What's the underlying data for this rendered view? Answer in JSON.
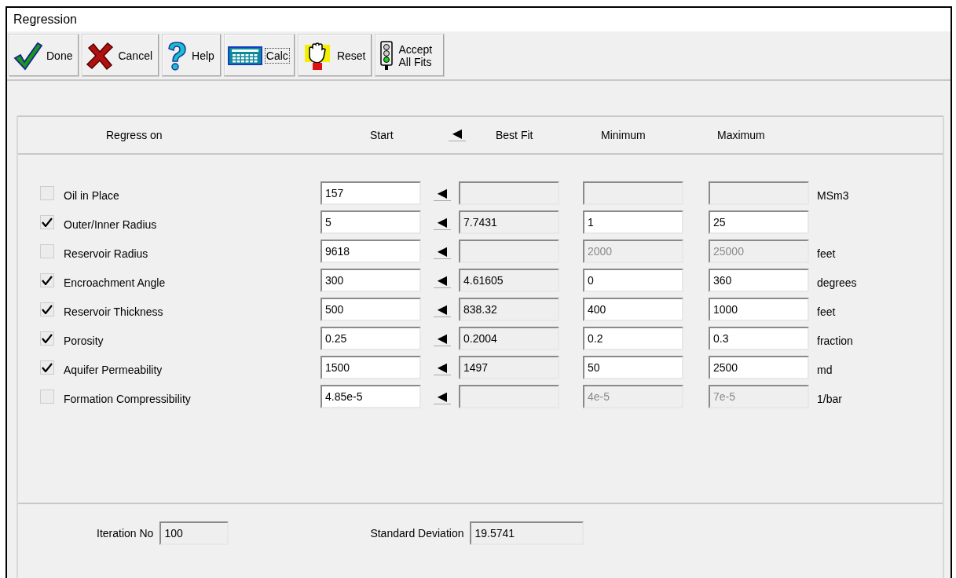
{
  "window": {
    "title": "Regression"
  },
  "toolbar": [
    {
      "kind": "done",
      "label": "Done",
      "focused": false
    },
    {
      "kind": "cancel",
      "label": "Cancel",
      "focused": false
    },
    {
      "kind": "help",
      "label": "Help",
      "focused": false
    },
    {
      "kind": "calc",
      "label": "Calc",
      "focused": true
    },
    {
      "kind": "reset",
      "label": "Reset",
      "focused": false
    },
    {
      "kind": "accept",
      "label": "Accept All Fits",
      "focused": false
    }
  ],
  "table": {
    "columns": [
      "Regress on",
      "Start",
      "◀",
      "Best Fit",
      "Minimum",
      "Maximum"
    ],
    "rows": [
      {
        "checked": false,
        "label": "Oil in Place",
        "start": "157",
        "arrow": "◀",
        "best_fit": "",
        "minimum": "",
        "maximum": "",
        "limits_enabled": false,
        "unit": "MSm3"
      },
      {
        "checked": true,
        "label": "Outer/Inner Radius",
        "start": "5",
        "arrow": "◀",
        "best_fit": "7.7431",
        "minimum": "1",
        "maximum": "25",
        "limits_enabled": true
      },
      {
        "checked": false,
        "label": "Reservoir Radius",
        "start": "9618",
        "arrow": "◀",
        "best_fit": "",
        "minimum": "2000",
        "maximum": "25000",
        "limits_enabled": false,
        "unit": "feet"
      },
      {
        "checked": true,
        "label": "Encroachment Angle",
        "start": "300",
        "arrow": "◀",
        "best_fit": "4.61605",
        "minimum": "0",
        "maximum": "360",
        "limits_enabled": true,
        "unit": "degrees"
      },
      {
        "checked": true,
        "label": "Reservoir Thickness",
        "start": "500",
        "arrow": "◀",
        "best_fit": "838.32",
        "minimum": "400",
        "maximum": "1000",
        "limits_enabled": true,
        "unit": "feet"
      },
      {
        "checked": true,
        "label": "Porosity",
        "start": "0.25",
        "arrow": "◀",
        "best_fit": "0.2004",
        "minimum": "0.2",
        "maximum": "0.3",
        "limits_enabled": true,
        "unit": "fraction"
      },
      {
        "checked": true,
        "label": "Aquifer Permeability",
        "start": "1500",
        "arrow": "◀",
        "best_fit": "1497",
        "minimum": "50",
        "maximum": "2500",
        "limits_enabled": true,
        "unit": "md"
      },
      {
        "checked": false,
        "label": "Formation Compressibility",
        "start": "4.85e-5",
        "arrow": "◀",
        "best_fit": "",
        "minimum": "4e-5",
        "maximum": "7e-5",
        "limits_enabled": false,
        "unit": "1/bar"
      }
    ]
  },
  "status": {
    "iteration_label": "Iteration No",
    "iteration": "100",
    "deviation_label": "Standard Deviation",
    "deviation": "19.5741"
  }
}
